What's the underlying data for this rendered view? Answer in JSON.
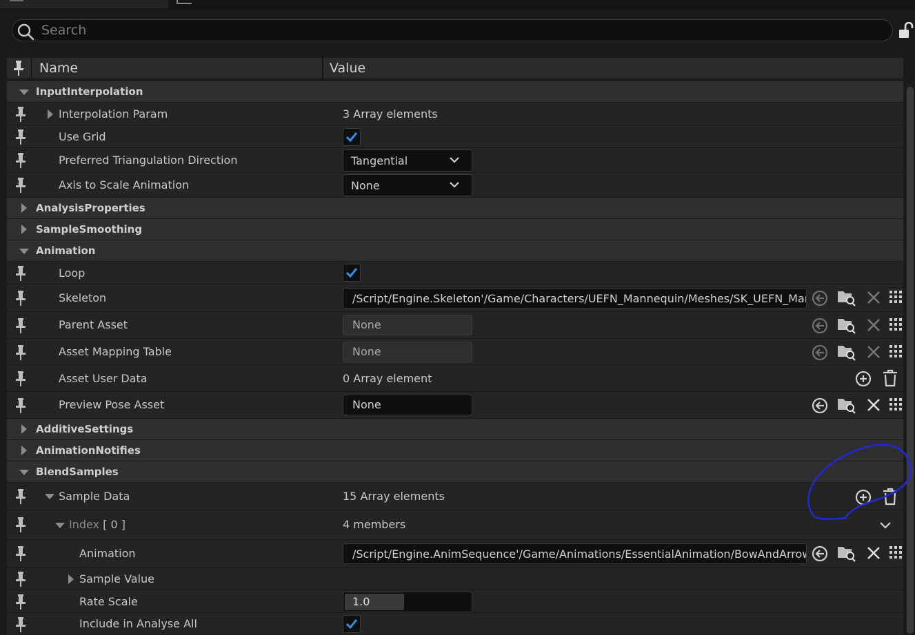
{
  "search": {
    "placeholder": "Search"
  },
  "header": {
    "name": "Name",
    "value": "Value"
  },
  "categories": {
    "input_interpolation": "InputInterpolation",
    "analysis_properties": "AnalysisProperties",
    "sample_smoothing": "SampleSmoothing",
    "animation": "Animation",
    "additive_settings": "AdditiveSettings",
    "animation_notifies": "AnimationNotifies",
    "blend_samples": "BlendSamples"
  },
  "input_interpolation": {
    "interpolation_param": {
      "label": "Interpolation Param",
      "value": "3 Array elements"
    },
    "use_grid": {
      "label": "Use Grid",
      "checked": true
    },
    "preferred_triangulation": {
      "label": "Preferred Triangulation Direction",
      "value": "Tangential"
    },
    "axis_to_scale": {
      "label": "Axis to Scale Animation",
      "value": "None"
    }
  },
  "animation": {
    "loop": {
      "label": "Loop",
      "checked": true
    },
    "skeleton": {
      "label": "Skeleton",
      "value": "/Script/Engine.Skeleton'/Game/Characters/UEFN_Mannequin/Meshes/SK_UEFN_Mannequin.SK_UEFN_Mannequin'"
    },
    "parent_asset": {
      "label": "Parent Asset",
      "value": "None"
    },
    "asset_mapping_table": {
      "label": "Asset Mapping Table",
      "value": "None"
    },
    "asset_user_data": {
      "label": "Asset User Data",
      "value": "0 Array element"
    },
    "preview_pose_asset": {
      "label": "Preview Pose Asset",
      "value": "None"
    }
  },
  "blend_samples": {
    "sample_data": {
      "label": "Sample Data",
      "value": "15 Array elements"
    },
    "index0": {
      "label": "Index",
      "index_suffix": "[ 0 ]",
      "value": "4 members"
    },
    "animation": {
      "label": "Animation",
      "value": "/Script/Engine.AnimSequence'/Game/Animations/EssentialAnimation/BowAndArrow/Anim_Bow_Idle'"
    },
    "sample_value": {
      "label": "Sample Value"
    },
    "rate_scale": {
      "label": "Rate Scale",
      "value": "1.0",
      "slider_fraction": 0.47
    },
    "include_in_analyse_all": {
      "label": "Include in Analyse All",
      "checked": true
    }
  },
  "colors": {
    "accent_check": "#2f8fe8",
    "annotation": "#1f2bd6",
    "background": "#1a1a1a",
    "row": "#242424",
    "category_row": "#2f2f2f"
  },
  "icons": [
    "search-icon",
    "unlock-icon",
    "pin-icon",
    "reset-arrow-icon",
    "browse-folder-icon",
    "clear-x-icon",
    "grid-picker-icon",
    "add-circle-icon",
    "trash-icon",
    "chevron-down-icon",
    "checkmark-icon"
  ]
}
